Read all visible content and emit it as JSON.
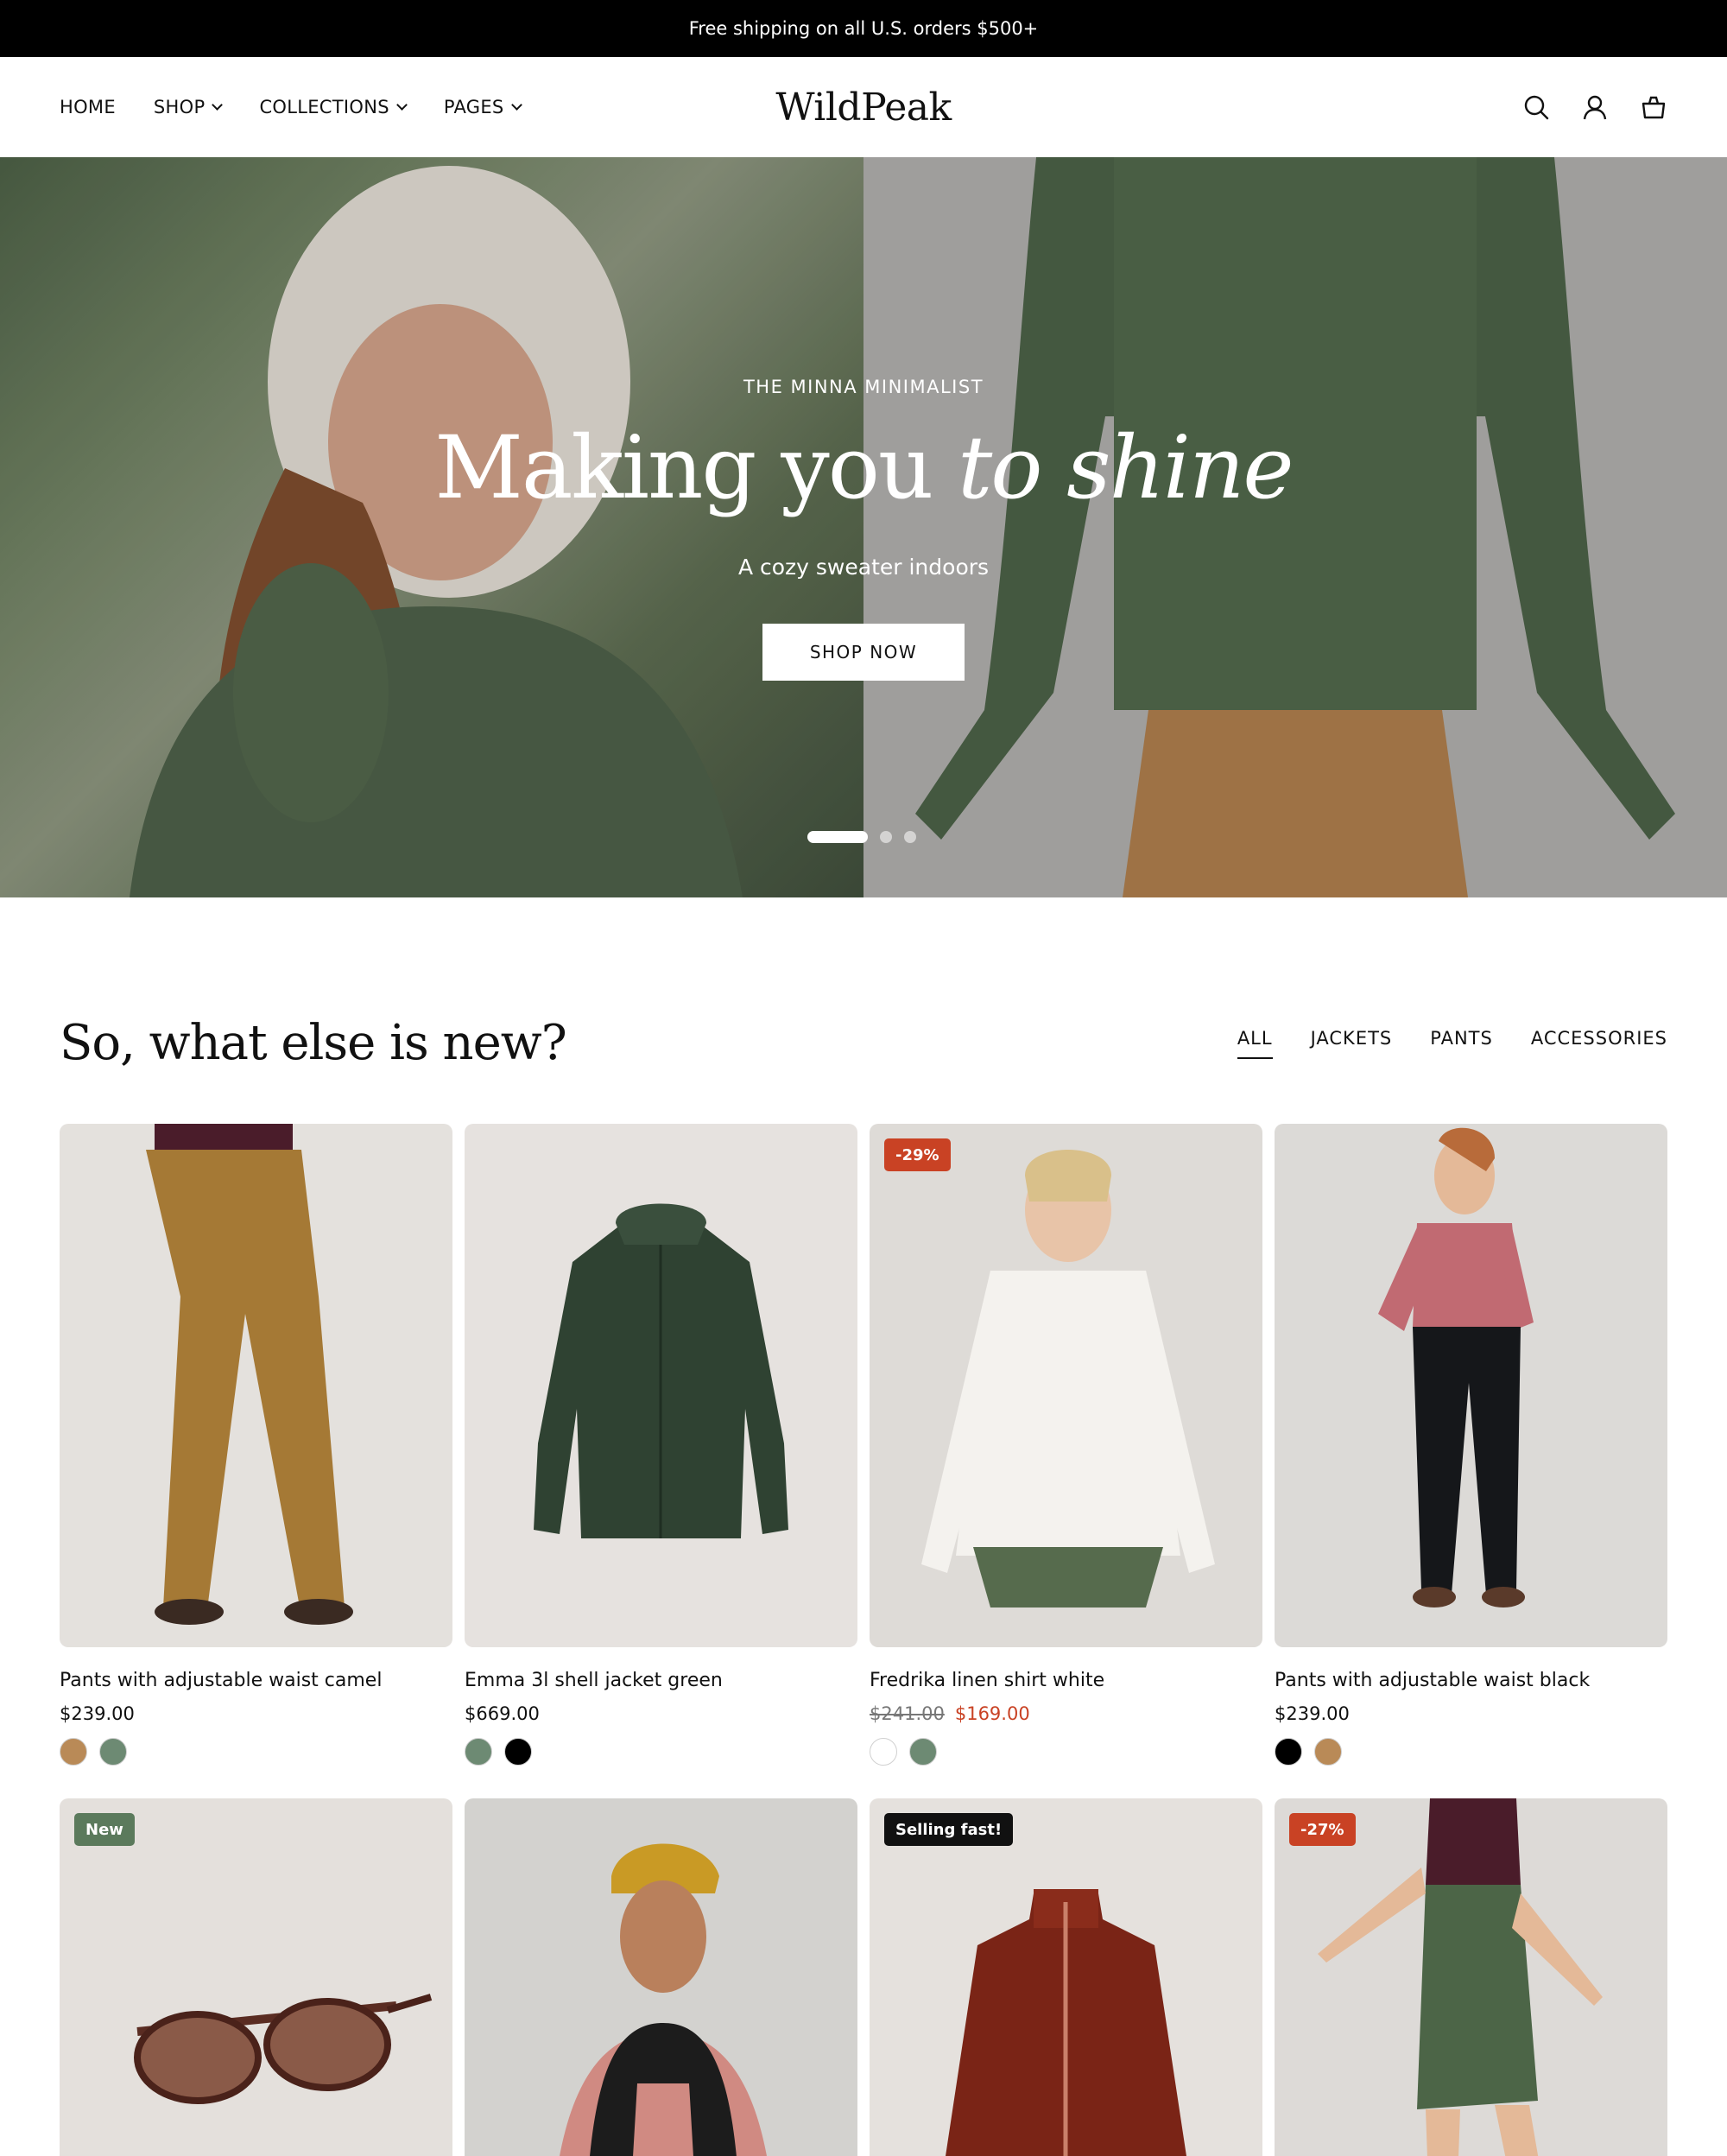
{
  "announcement": "Free shipping on all U.S. orders $500+",
  "header": {
    "logo": "WildPeak",
    "nav": [
      {
        "label": "HOME"
      },
      {
        "label": "SHOP"
      },
      {
        "label": "COLLECTIONS"
      },
      {
        "label": "PAGES"
      }
    ],
    "icons": [
      "search-icon",
      "account-icon",
      "cart-icon"
    ]
  },
  "hero": {
    "eyebrow": "THE MINNA MINIMALIST",
    "headline_main": "Making you ",
    "headline_italic": "to shine",
    "subline": "A cozy sweater indoors",
    "button": "SHOP NOW",
    "slides": 3,
    "active_slide": 1
  },
  "section": {
    "title": "So, what else is new?",
    "filters": [
      "ALL",
      "JACKETS",
      "PANTS",
      "ACCESSORIES"
    ],
    "active_filter": "ALL"
  },
  "colors": {
    "sale": "#c94224",
    "new_badge": "#5b7a5c",
    "camel": "#b98a57",
    "sage": "#6d8a73",
    "black": "#000000",
    "white": "#ffffff"
  },
  "products": [
    {
      "name": "Pants with adjustable waist camel",
      "price": "$239.00",
      "swatches": [
        "#b98a57",
        "#6d8a73"
      ]
    },
    {
      "name": "Emma 3l shell jacket green",
      "price": "$669.00",
      "swatches": [
        "#6d8a73",
        "#000000"
      ]
    },
    {
      "name": "Fredrika linen shirt white",
      "old_price": "$241.00",
      "sale_price": "$169.00",
      "badge": "-29%",
      "swatches": [
        "#ffffff",
        "#6d8a73"
      ]
    },
    {
      "name": "Pants with adjustable waist black",
      "price": "$239.00",
      "swatches": [
        "#000000",
        "#b98a57"
      ]
    }
  ],
  "products_row2": [
    {
      "badge": "New"
    },
    {},
    {
      "badge": "Selling fast!"
    },
    {
      "badge": "-27%"
    }
  ]
}
